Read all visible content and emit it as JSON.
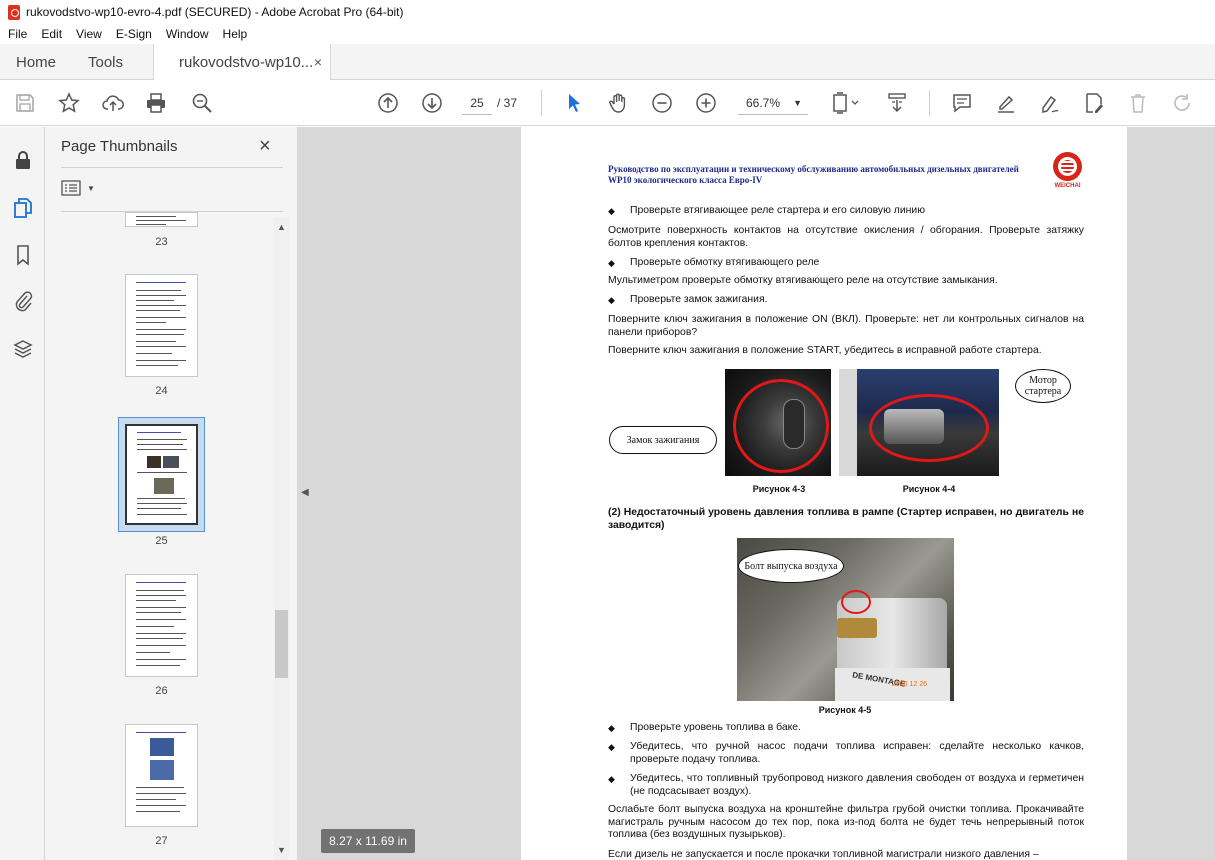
{
  "window": {
    "title": "rukovodstvo-wp10-evro-4.pdf (SECURED) - Adobe Acrobat Pro (64-bit)"
  },
  "menu": [
    "File",
    "Edit",
    "View",
    "E-Sign",
    "Window",
    "Help"
  ],
  "tabs": {
    "home": "Home",
    "tools": "Tools",
    "document": "rukovodstvo-wp10...",
    "close": "×"
  },
  "toolbar": {
    "page_current": "25",
    "page_total": "/ 37",
    "zoom": "66.7%"
  },
  "thumbnails": {
    "title": "Page Thumbnails",
    "close": "×",
    "pages": [
      "23",
      "24",
      "25",
      "26",
      "27"
    ],
    "selected": "25"
  },
  "document": {
    "header": "Руководство по эксплуатации и техническому обслуживанию автомобильных дизельных двигателей WP10 экологического класса Евро-IV",
    "logo_text": "WEICHAI",
    "b1": "Проверьте втягивающее реле стартера и его силовую линию",
    "p1": "Осмотрите поверхность контактов на отсутствие окисления / обгорания. Проверьте затяжку болтов крепления контактов.",
    "b2": "Проверьте обмотку втягивающего реле",
    "p2": "Мультиметром проверьте обмотку втягивающего реле на отсутствие замыкания.",
    "b3": "Проверьте замок зажигания.",
    "p3": "Поверните ключ зажигания в положение ON (ВКЛ). Проверьте: нет ли контрольных сигналов на панели приборов?",
    "p4": "Поверните ключ зажигания в положение START, убедитесь в исправной работе стартера.",
    "callout_ignition": "Замок зажигания",
    "callout_starter": "Мотор стартера",
    "caption_43": "Рисунок 4-3",
    "caption_44": "Рисунок 4-4",
    "h2": "(2)   Недостаточный уровень давления топлива в рампе (Стартер исправен, но двигатель не заводится)",
    "callout_bolt": "Болт выпуска воздуха",
    "caption_45": "Рисунок 4-5",
    "photo_stamp": "2006 12 26",
    "photo_label": "DE MONTAGE",
    "b4": "Проверьте уровень топлива в баке.",
    "b5": "Убедитесь, что ручной насос подачи топлива исправен: сделайте несколько качков, проверьте подачу топлива.",
    "b6": "Убедитесь, что топливный трубопровод низкого давления свободен от воздуха и герметичен (не подсасывает воздух).",
    "p5": "Ослабьте болт выпуска воздуха на кронштейне фильтра грубой очистки топлива. Прокачивайте магистраль ручным насосом до тех пор, пока из-под болта не будет течь непрерывный поток топлива (без воздушных пузырьков).",
    "p6": "Если дизель не запускается и после прокачки топливной магистрали низкого давления –"
  },
  "status": {
    "page_size": "8.27 x 11.69 in"
  },
  "colors": {
    "accent_blue": "#1b72d8",
    "logo_red": "#d9241a",
    "header_blue": "#1b2a8c"
  }
}
